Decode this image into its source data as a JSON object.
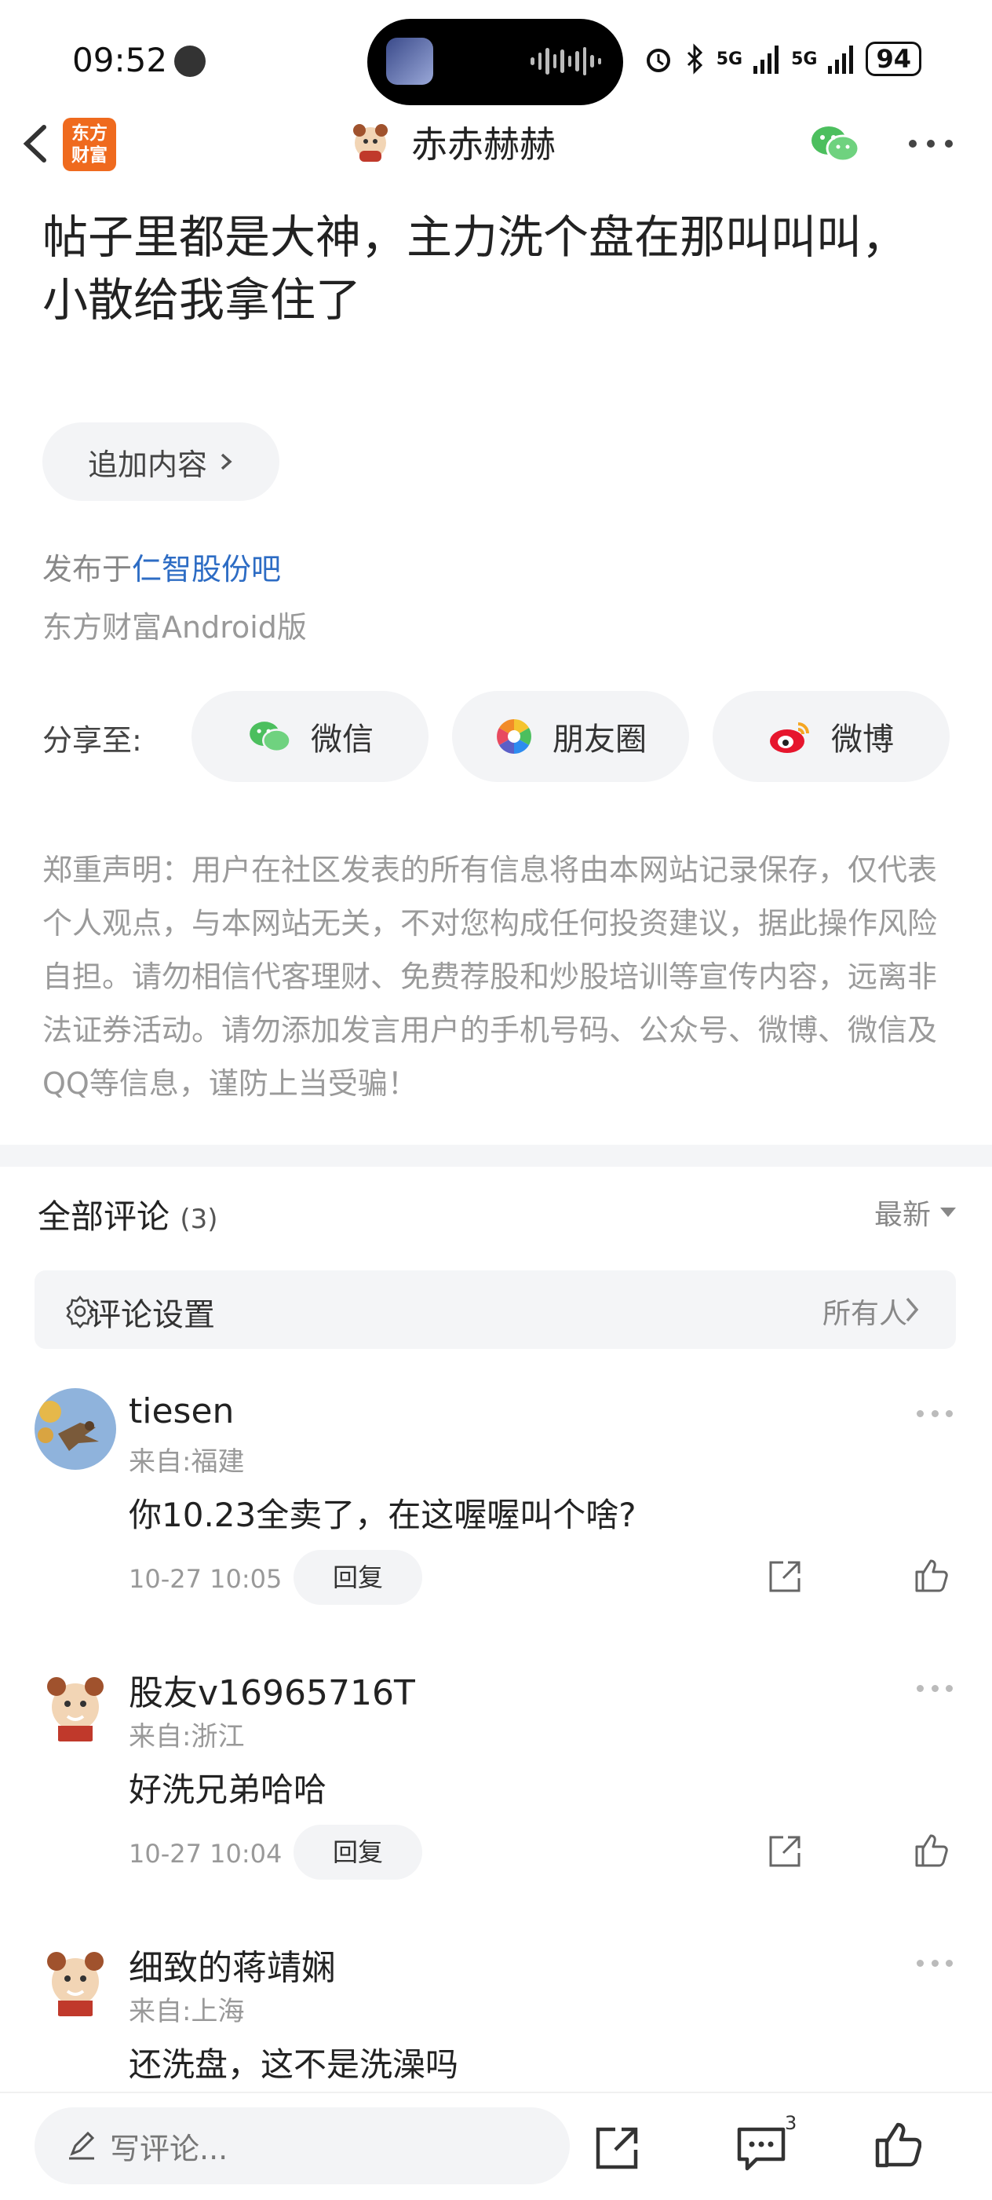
{
  "status_bar": {
    "time": "09:52",
    "network1": "5G",
    "network2": "5G",
    "battery": "94"
  },
  "header": {
    "app_logo_text": "东方财富",
    "username": "赤赤赫赫"
  },
  "post": {
    "title": "帖子里都是大神，主力洗个盘在那叫叫叫，小散给我拿住了",
    "append_label": "追加内容",
    "published_prefix": "发布于",
    "bar_name": "仁智股份吧",
    "client": "东方财富Android版"
  },
  "share": {
    "label": "分享至:",
    "wechat": "微信",
    "moments": "朋友圈",
    "weibo": "微博"
  },
  "disclaimer": "郑重声明：用户在社区发表的所有信息将由本网站记录保存，仅代表个人观点，与本网站无关，不对您构成任何投资建议，据此操作风险自担。请勿相信代客理财、免费荐股和炒股培训等宣传内容，远离非法证券活动。请勿添加发言用户的手机号码、公众号、微博、微信及QQ等信息，谨防上当受骗！",
  "comments": {
    "title": "全部评论",
    "count": "(3)",
    "sort_label": "最新",
    "settings_label": "评论设置",
    "settings_value": "所有人",
    "items": [
      {
        "name": "tiesen",
        "location": "来自:福建",
        "text": "你10.23全卖了，在这喔喔叫个啥?",
        "time": "10-27 10:05",
        "reply": "回复"
      },
      {
        "name": "股友v16965716T",
        "location": "来自:浙江",
        "text": "好洗兄弟哈哈",
        "time": "10-27 10:04",
        "reply": "回复"
      },
      {
        "name": "细致的蒋靖娴",
        "location": "来自:上海",
        "text": "还洗盘，这不是洗澡吗"
      }
    ]
  },
  "bottom_bar": {
    "write_placeholder": "写评论...",
    "comment_badge": "3"
  }
}
